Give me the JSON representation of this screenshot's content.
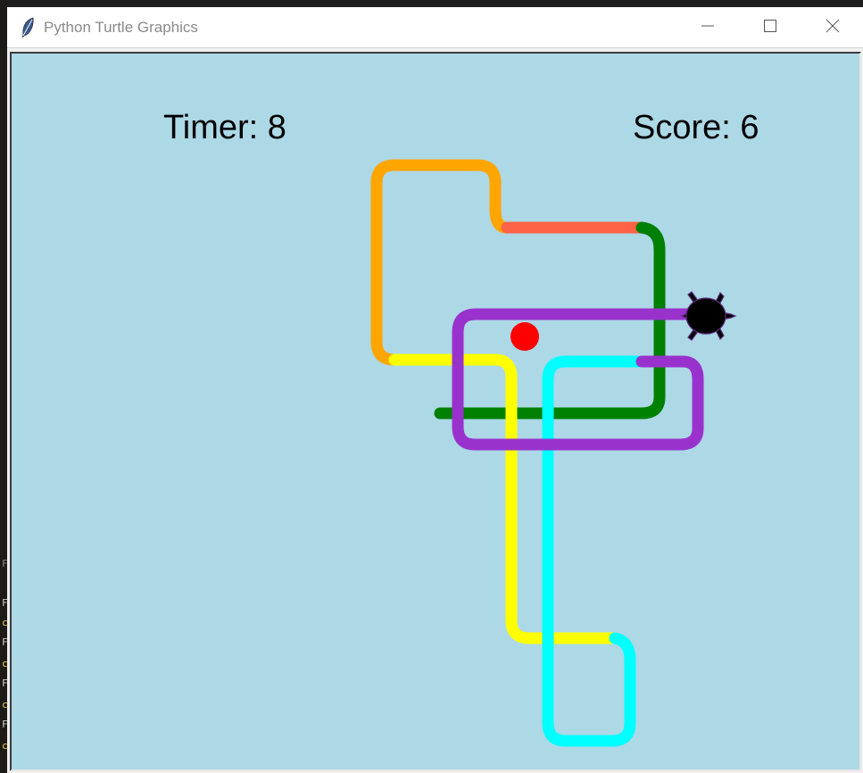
{
  "window": {
    "title": "Python Turtle Graphics",
    "app_icon": "feather-icon",
    "controls": [
      "minimize-icon",
      "maximize-icon",
      "close-icon"
    ]
  },
  "game": {
    "timer_label": "Timer: 8",
    "score_label": "Score: 6",
    "background_color": "#add8e6",
    "player": "turtle-icon",
    "target": "red-dot",
    "trail_colors": {
      "orange": "#ffa500",
      "tomato": "#ff6347",
      "green": "#008000",
      "purple": "#9932cc",
      "yellow": "#ffff00",
      "cyan": "#00ffff",
      "turtle": "#000000",
      "food": "#ff0000"
    }
  }
}
